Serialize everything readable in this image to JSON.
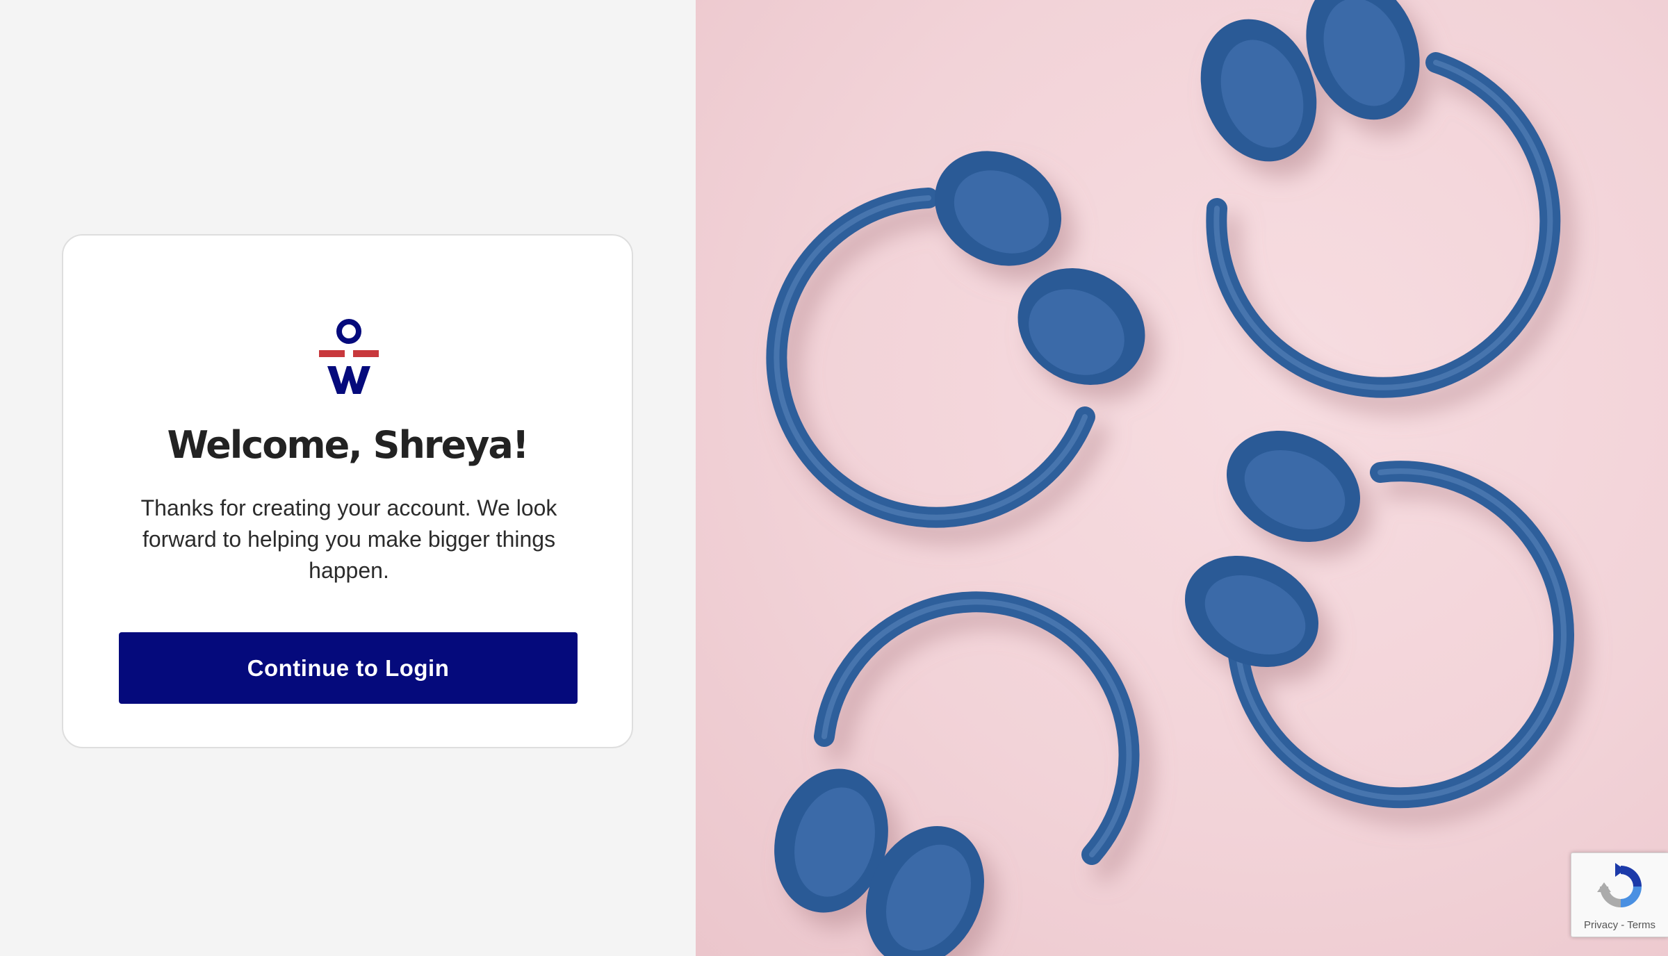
{
  "brand": {
    "logo_icon": "ow-logo-icon",
    "colors": {
      "navy": "#050a7c",
      "red": "#c8383c"
    }
  },
  "welcome": {
    "title": "Welcome, Shreya!",
    "message": "Thanks for creating your account. We look forward to helping you make bigger things happen."
  },
  "actions": {
    "continue_label": "Continue to Login"
  },
  "hero": {
    "image_icon": "headphones-photo",
    "colors": {
      "background": "#f2d3d8",
      "headphone": "#2f5f9b"
    }
  },
  "recaptcha": {
    "icon": "recaptcha-icon",
    "privacy_label": "Privacy",
    "separator": " - ",
    "terms_label": "Terms"
  }
}
